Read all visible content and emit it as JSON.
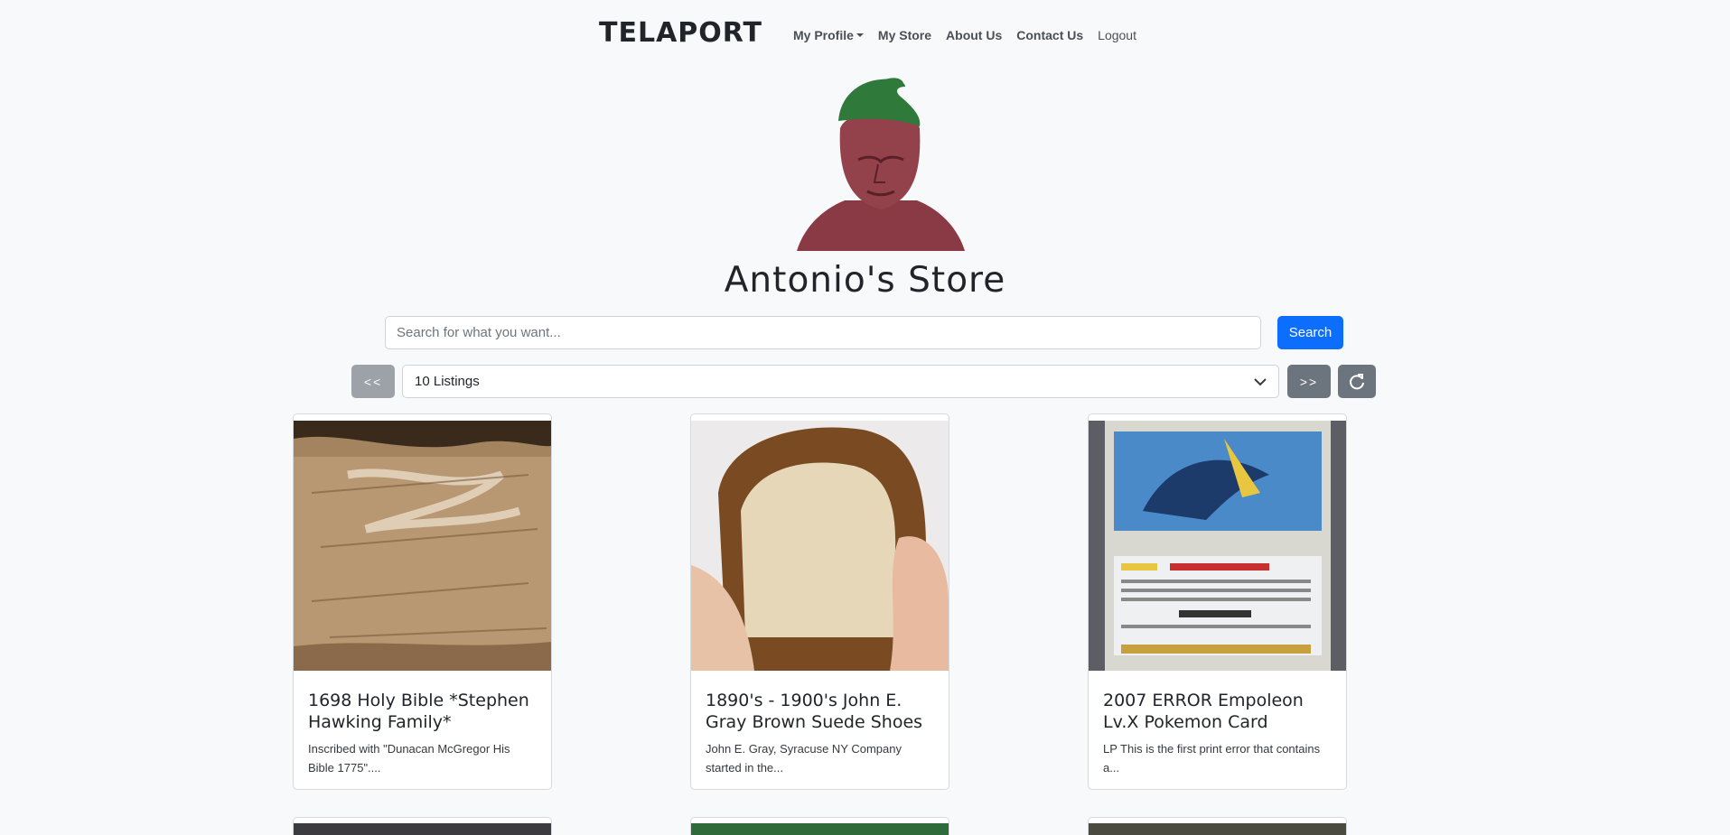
{
  "navbar": {
    "brand": "TELAPORT",
    "links": {
      "my_profile": "My Profile",
      "my_store": "My Store",
      "about_us": "About Us",
      "contact_us": "Contact Us",
      "logout": "Logout"
    }
  },
  "store": {
    "title": "Antonio's Store"
  },
  "search": {
    "placeholder": "Search for what you want...",
    "button": "Search"
  },
  "pagination": {
    "prev": "<<",
    "next": ">>",
    "listings_selected": "10 Listings",
    "refresh_icon": "refresh-icon"
  },
  "listings": [
    {
      "title": "1698 Holy Bible *Stephen Hawking Family*",
      "description": "Inscribed with \"Dunacan McGregor His Bible 1775\"...."
    },
    {
      "title": "1890's - 1900's John E. Gray Brown Suede Shoes",
      "description": "John E. Gray, Syracuse NY Company started in the..."
    },
    {
      "title": "2007 ERROR Empoleon Lv.X Pokemon Card",
      "description": "LP This is the first print error that contains a..."
    }
  ],
  "colors": {
    "primary": "#0d6efd",
    "secondary": "#6c757d",
    "background": "#f8f9fa"
  }
}
